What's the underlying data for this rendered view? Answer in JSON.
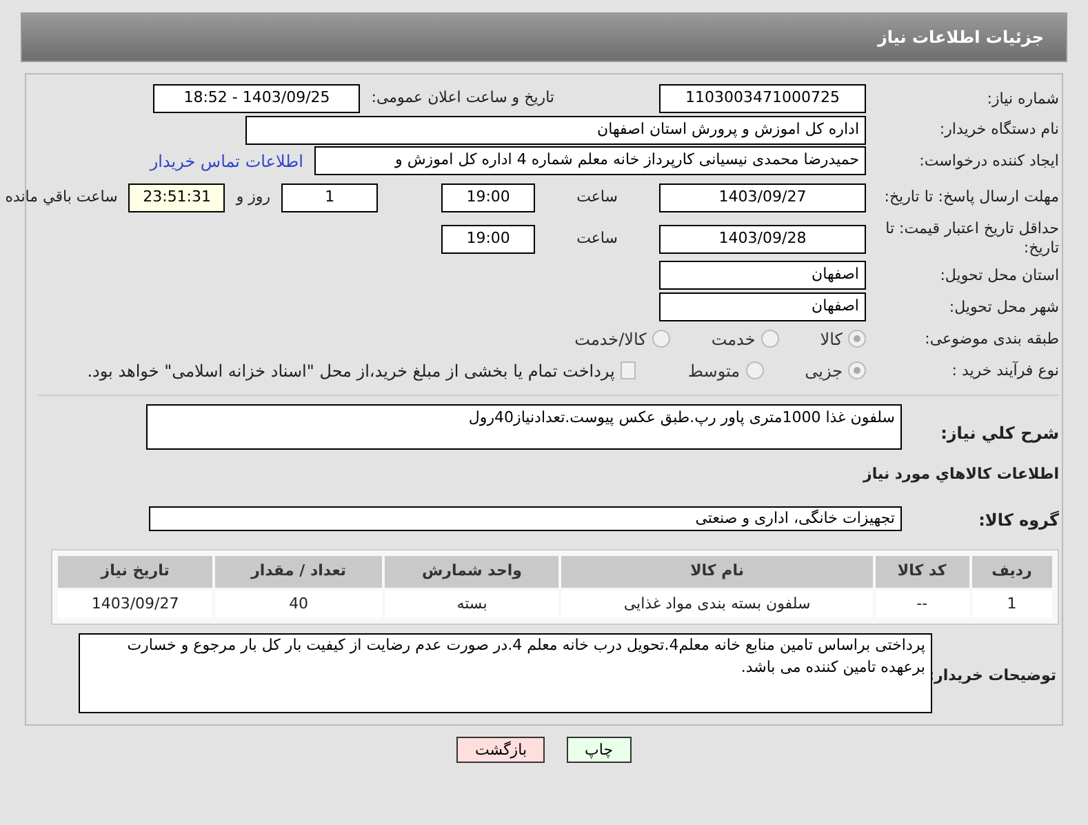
{
  "header": {
    "title": "جزئیات اطلاعات نیاز"
  },
  "need_number": {
    "label": "شماره نیاز:",
    "value": "1103003471000725"
  },
  "announce": {
    "label": "تاریخ و ساعت اعلان عمومی:",
    "value": "1403/09/25 - 18:52"
  },
  "buyer_org": {
    "label": "نام دستگاه خریدار:",
    "value": "اداره کل اموزش و پرورش استان اصفهان"
  },
  "requester": {
    "label": "ایجاد کننده درخواست:",
    "value": "حمیدرضا محمدی نیسیانی کارپرداز خانه معلم شماره 4 اداره کل اموزش و",
    "link": "اطلاعات تماس خریدار"
  },
  "reply_deadline": {
    "label": "مهلت ارسال پاسخ: تا تاریخ:",
    "date": "1403/09/27",
    "time_label": "ساعت",
    "time": "19:00",
    "days": "1",
    "days_label": "روز و",
    "remaining": "23:51:31",
    "remaining_label": "ساعت باقي مانده"
  },
  "price_validity": {
    "label": "حداقل تاریخ اعتبار قیمت: تا تاریخ:",
    "date": "1403/09/28",
    "time_label": "ساعت",
    "time": "19:00"
  },
  "province": {
    "label": "استان محل تحویل:",
    "value": "اصفهان"
  },
  "city": {
    "label": "شهر محل تحویل:",
    "value": "اصفهان"
  },
  "category": {
    "label": "طبقه بندی موضوعی:",
    "options": [
      {
        "label": "کالا",
        "selected": true
      },
      {
        "label": "خدمت",
        "selected": false
      },
      {
        "label": "کالا/خدمت",
        "selected": false
      }
    ]
  },
  "purchase_type": {
    "label": "نوع فرآیند خرید :",
    "options": [
      {
        "label": "جزیی",
        "selected": true
      },
      {
        "label": "متوسط",
        "selected": false
      }
    ],
    "payment_checkbox": {
      "label": "پرداخت تمام یا بخشی از مبلغ خرید،از محل \"اسناد خزانه اسلامی\" خواهد بود.",
      "checked": false
    }
  },
  "description": {
    "label": "شرح کلي نياز:",
    "value": "سلفون غذا 1000متری پاور رپ.طبق عکس پیوست.تعدادنیاز40رول"
  },
  "goods_section": {
    "title": "اطلاعات کالاهاي مورد نياز"
  },
  "goods_group": {
    "label": "گروه کالا:",
    "value": "تجهیزات خانگی، اداری و صنعتی"
  },
  "table": {
    "columns": [
      "ردیف",
      "کد کالا",
      "نام کالا",
      "واحد شمارش",
      "تعداد / مقدار",
      "تاریخ نیاز"
    ],
    "rows": [
      [
        "1",
        "--",
        "سلفون بسته بندی مواد غذایی",
        "بسته",
        "40",
        "1403/09/27"
      ]
    ]
  },
  "buyer_notes": {
    "label": "توضیحات خریدار:",
    "value": "پرداختی براساس تامین منابع خانه معلم4.تحویل درب خانه معلم 4.در صورت عدم رضایت از کیفیت بار کل بار مرجوع و خسارت برعهده تامین کننده می باشد."
  },
  "buttons": [
    {
      "label": "چاپ",
      "kind": "print"
    },
    {
      "label": "بازگشت",
      "kind": "back"
    }
  ]
}
